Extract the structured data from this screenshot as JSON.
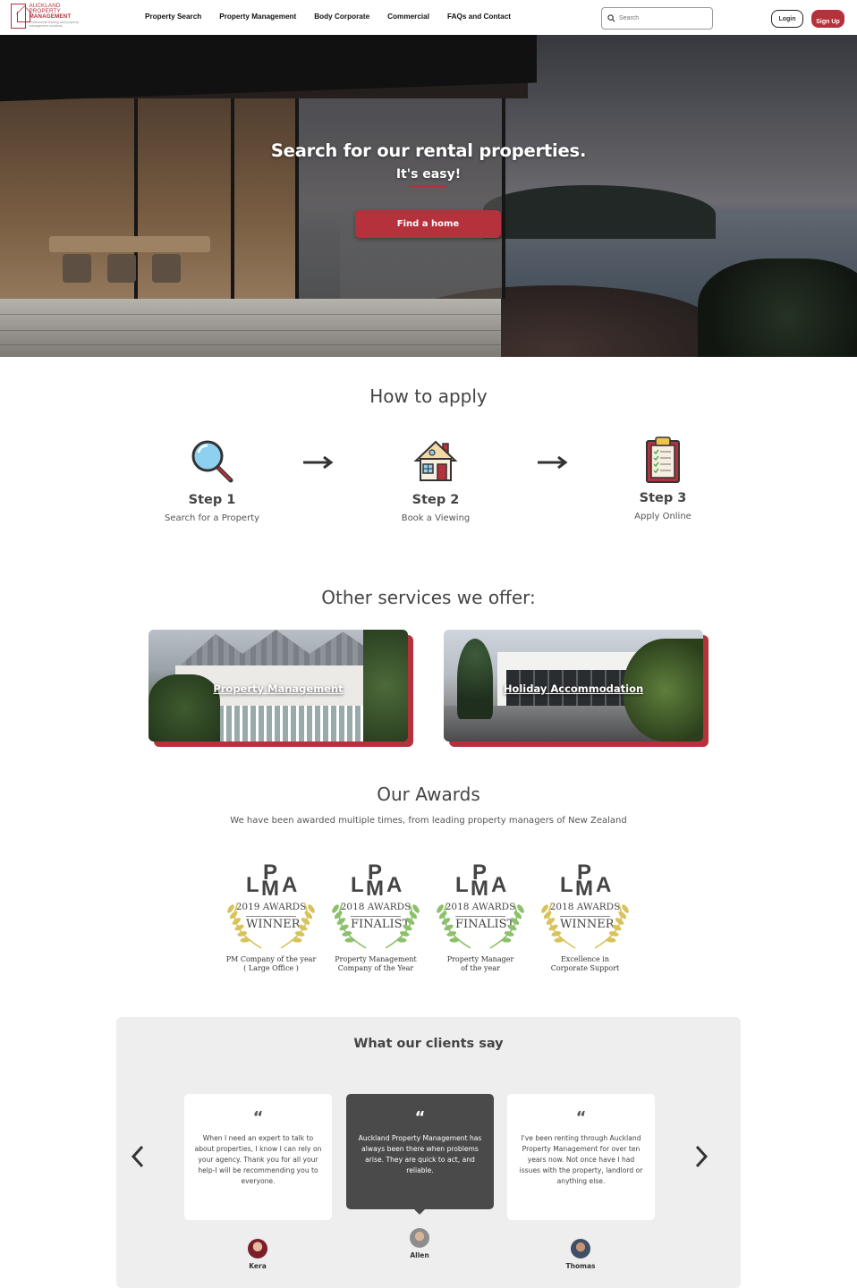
{
  "header": {
    "logo": {
      "line1": "AUCKLAND",
      "line2": "PROPERTY",
      "line3": "MANAGEMENT",
      "tagline": "Professional leasing and property management solutions"
    },
    "nav": [
      "Property Search",
      "Property Management",
      "Body Corporate",
      "Commercial",
      "FAQs and Contact"
    ],
    "search_placeholder": "Search",
    "login_label": "Login",
    "signup_label": "Sign Up"
  },
  "hero": {
    "title": "Search for our rental properties.",
    "subtitle": "It's easy!",
    "button_label": "Find a home"
  },
  "how_to_apply": {
    "title": "How to apply",
    "steps": [
      {
        "label": "Step 1",
        "desc": "Search for a Property",
        "icon": "magnifier-icon"
      },
      {
        "label": "Step 2",
        "desc": "Book a Viewing",
        "icon": "house-icon"
      },
      {
        "label": "Step 3",
        "desc": "Apply Online",
        "icon": "clipboard-icon"
      }
    ]
  },
  "services": {
    "title": "Other services we offer:",
    "items": [
      {
        "label": "Property Management"
      },
      {
        "label": "Holiday Accommodation"
      }
    ]
  },
  "awards": {
    "title": "Our Awards",
    "subtitle": "We have been awarded multiple times, from leading property managers of New Zealand",
    "items": [
      {
        "year": "2019 AWARDS",
        "result": "WINNER",
        "caption1": "PM Company of the year",
        "caption2": "( Large Office )",
        "color": "#d8c25a"
      },
      {
        "year": "2018 AWARDS",
        "result": "FINALIST",
        "caption1": "Property Management",
        "caption2": "Company of the Year",
        "color": "#8cc06a"
      },
      {
        "year": "2018 AWARDS",
        "result": "FINALIST",
        "caption1": "Property Manager",
        "caption2": "of the year",
        "color": "#8cc06a"
      },
      {
        "year": "2018 AWARDS",
        "result": "WINNER",
        "caption1": "Excellence in",
        "caption2": "Corporate Support",
        "color": "#d8c25a"
      }
    ]
  },
  "testimonials": {
    "title": "What our clients say",
    "items": [
      {
        "text": "When I need an expert to talk to about properties, I know I can rely on your agency. Thank you for all your help-I will be recommending you to everyone.",
        "name": "Kera"
      },
      {
        "text": "Auckland Property Management has always been there when problems arise. They are quick to act, and reliable.",
        "name": "Allen"
      },
      {
        "text": "I've been renting through Auckland Property Management for over ten years now. Not once have I had issues with the property, landlord or anything else.",
        "name": "Thomas"
      }
    ]
  },
  "colors": {
    "accent": "#b5313c",
    "dark_card": "#4a4a4a",
    "panel": "#eeeeee"
  }
}
